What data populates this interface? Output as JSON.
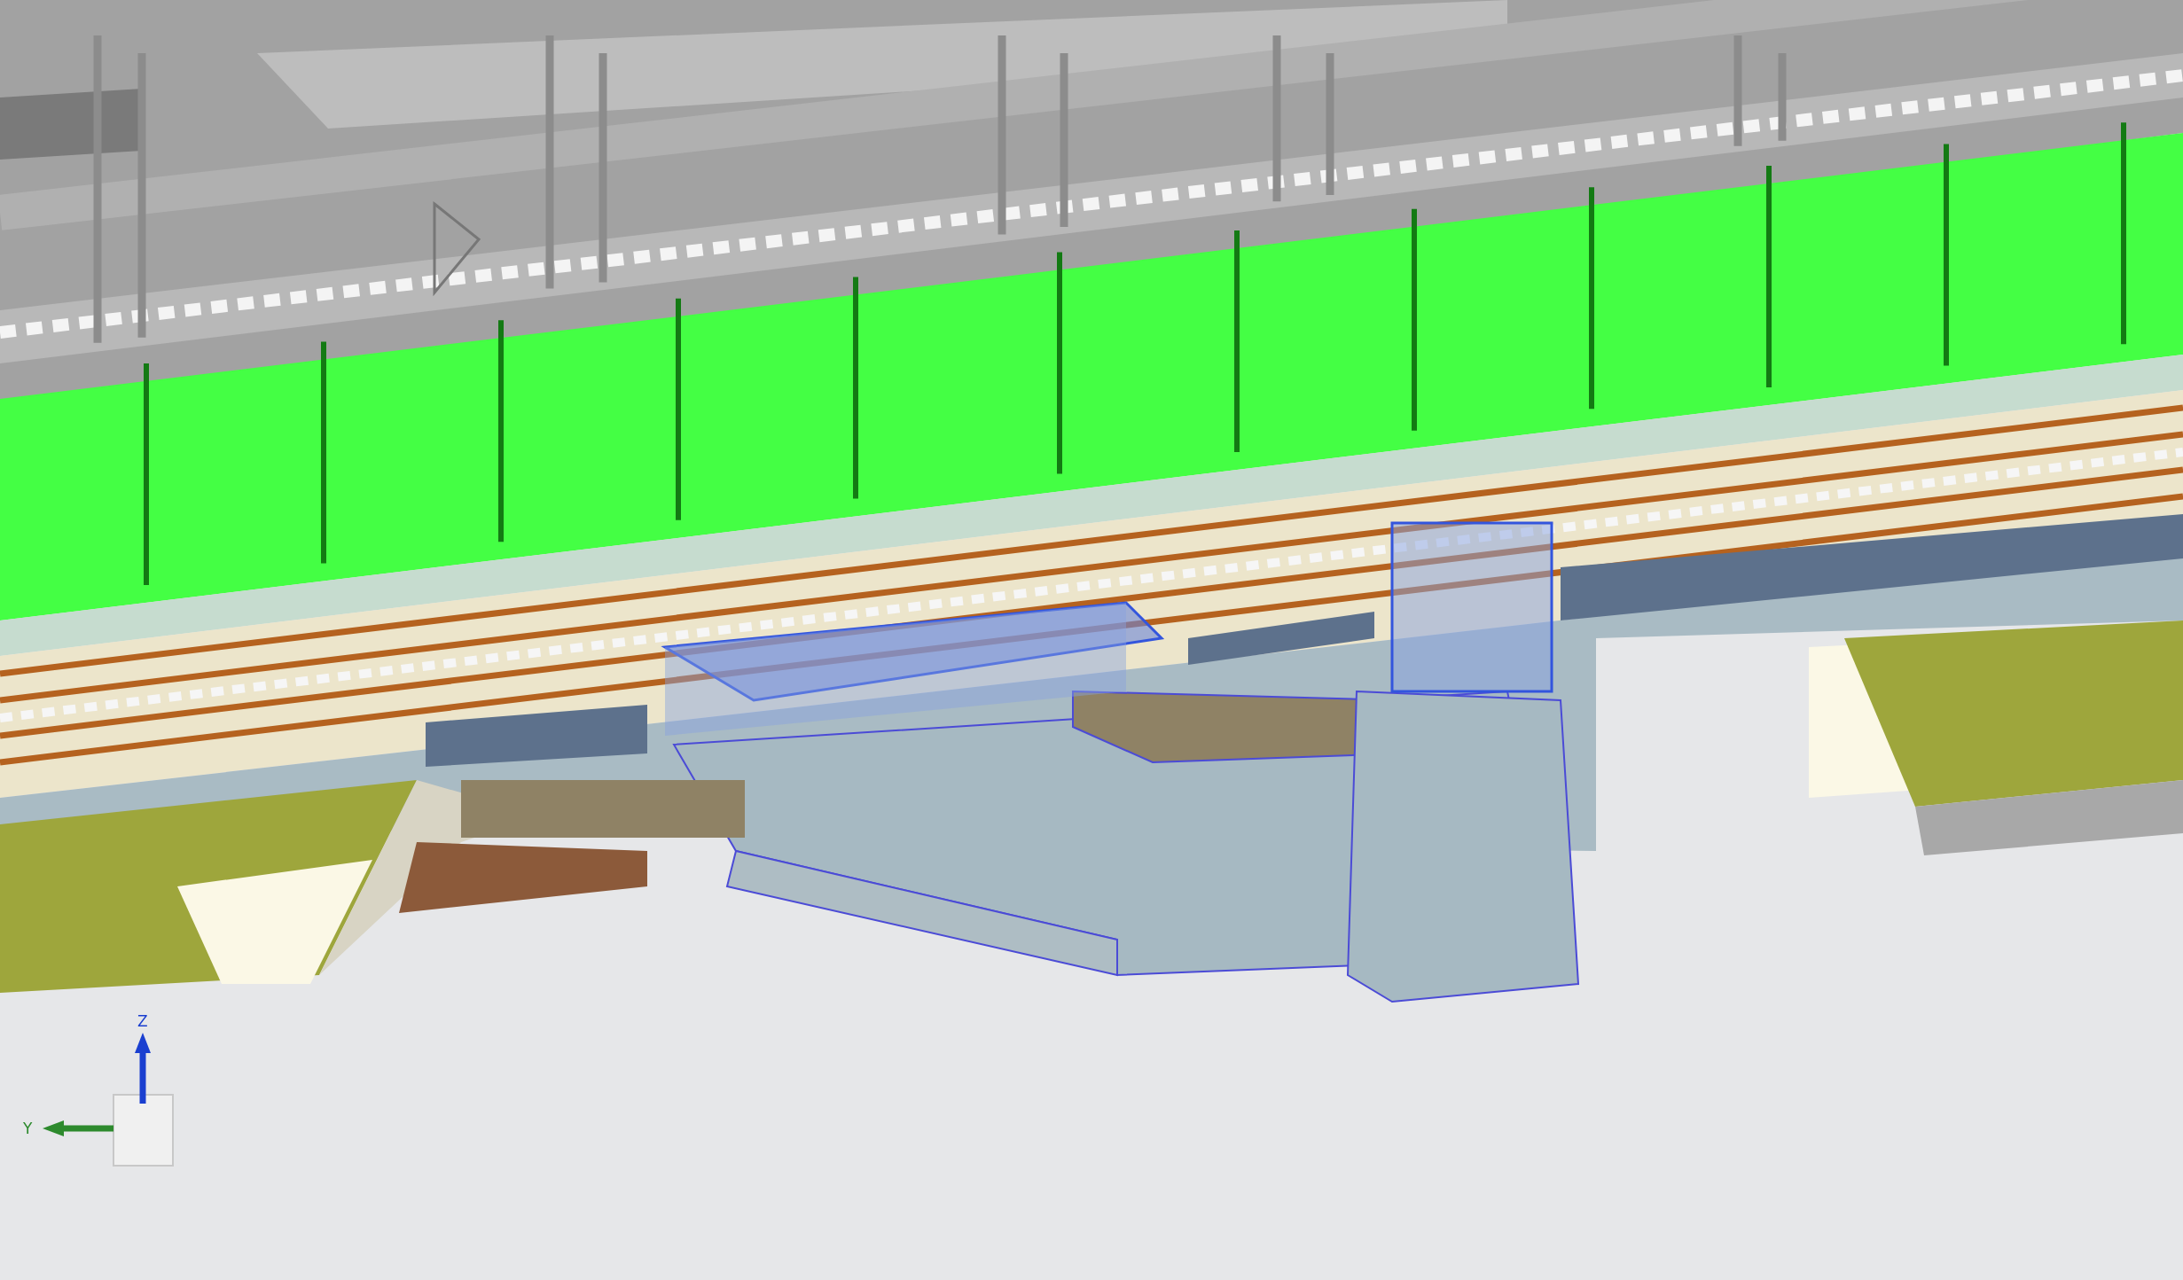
{
  "axis_triad": {
    "z_label": "Z",
    "y_label": "Y"
  }
}
